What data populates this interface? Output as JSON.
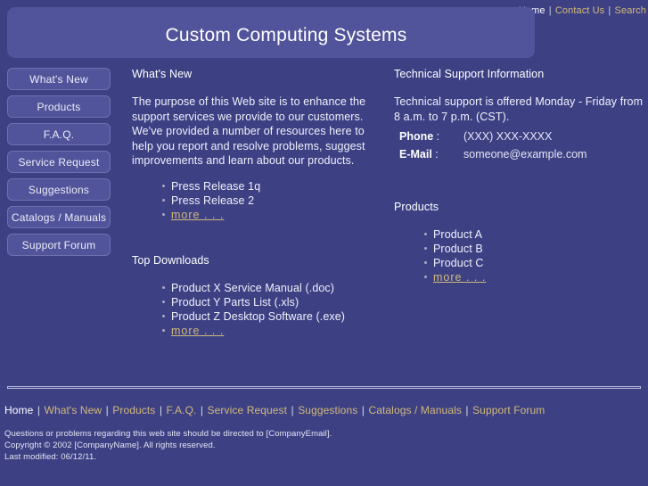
{
  "topnav": {
    "links": [
      {
        "label": "Home",
        "current": true
      },
      {
        "label": "Contact Us",
        "current": false
      },
      {
        "label": "Search",
        "current": false
      }
    ],
    "separator": "|"
  },
  "banner": {
    "title": "Custom Computing Systems"
  },
  "sidebar": {
    "items": [
      {
        "label": "What's New"
      },
      {
        "label": "Products"
      },
      {
        "label": "F.A.Q."
      },
      {
        "label": "Service Request"
      },
      {
        "label": "Suggestions"
      },
      {
        "label": "Catalogs / Manuals"
      },
      {
        "label": "Support Forum"
      }
    ]
  },
  "left_column": {
    "whats_new": {
      "heading": "What's New",
      "paragraph": "The purpose of this Web site is to enhance the support services we provide to our customers. We've provided a number of resources here to help you report and resolve problems, suggest improvements and learn about our products.",
      "items": [
        {
          "label": "Press Release 1q",
          "link": false
        },
        {
          "label": "Press Release 2",
          "link": false
        },
        {
          "label": "more . . .",
          "link": true
        }
      ]
    },
    "top_downloads": {
      "heading": "Top Downloads",
      "items": [
        {
          "label": "Product X Service Manual (.doc)",
          "link": false
        },
        {
          "label": "Product Y Parts List (.xls)",
          "link": false
        },
        {
          "label": "Product Z Desktop Software (.exe)",
          "link": false
        },
        {
          "label": "more . . .",
          "link": true
        }
      ]
    }
  },
  "right_column": {
    "tech_support": {
      "heading": "Technical Support Information",
      "paragraph": "Technical support is offered Monday - Friday from 8 a.m. to 7 p.m. (CST).",
      "rows": [
        {
          "term": "Phone",
          "colon": ":",
          "value": "(XXX) XXX-XXXX"
        },
        {
          "term": "E-Mail",
          "colon": ":",
          "value": "someone@example.com"
        }
      ]
    },
    "products": {
      "heading": "Products",
      "items": [
        {
          "label": "Product A",
          "link": false
        },
        {
          "label": "Product B",
          "link": false
        },
        {
          "label": "Product C",
          "link": false
        },
        {
          "label": "more . . .",
          "link": true
        }
      ]
    }
  },
  "footer": {
    "links": [
      {
        "label": "Home",
        "current": true
      },
      {
        "label": "What's New",
        "current": false
      },
      {
        "label": "Products",
        "current": false
      },
      {
        "label": "F.A.Q.",
        "current": false
      },
      {
        "label": "Service Request",
        "current": false
      },
      {
        "label": "Suggestions",
        "current": false
      },
      {
        "label": "Catalogs / Manuals",
        "current": false
      },
      {
        "label": "Support Forum",
        "current": false
      }
    ],
    "separator": "|",
    "notes": [
      "Questions or problems regarding this web site should be directed to [CompanyEmail].",
      "Copyright © 2002 [CompanyName]. All rights reserved.",
      "Last modified: 06/12/11."
    ]
  },
  "colors": {
    "page_background": "#3d4184",
    "panel": "#51549a",
    "link": "#d2b879",
    "text": "#f0f0fa"
  }
}
